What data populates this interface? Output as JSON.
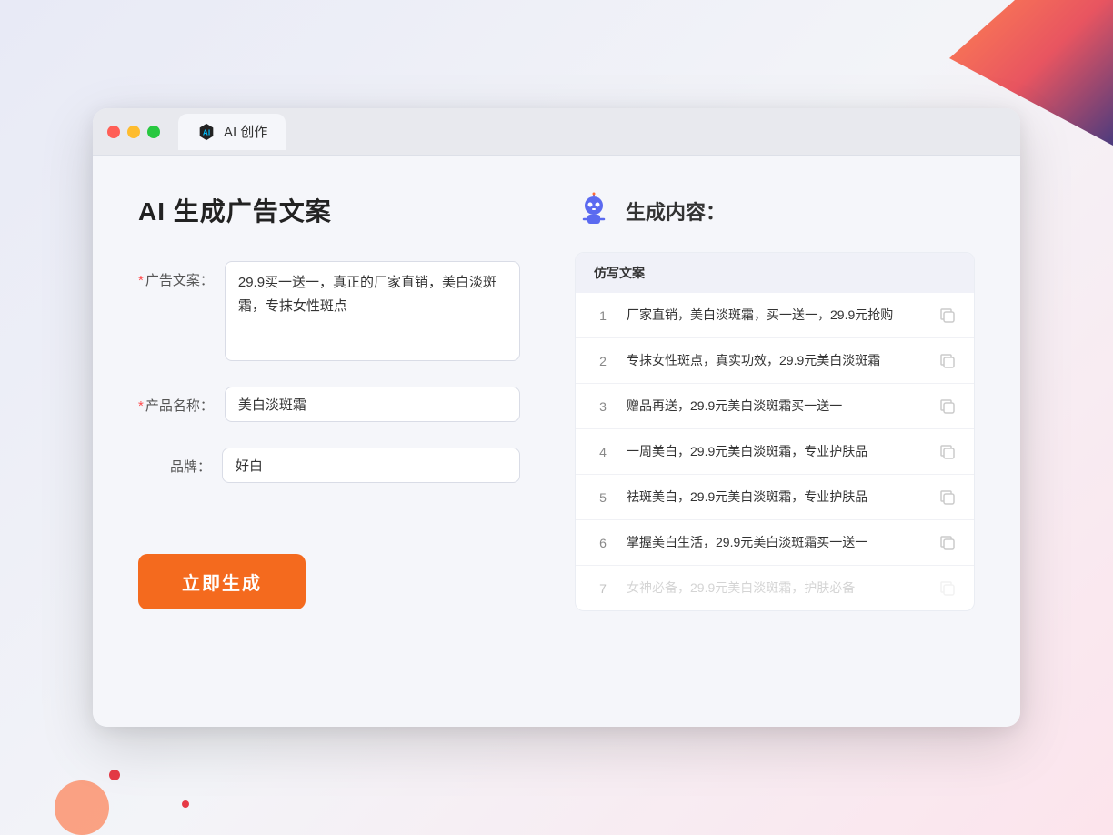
{
  "browser": {
    "tab_title": "AI 创作"
  },
  "page": {
    "title": "AI 生成广告文案",
    "form": {
      "ad_copy_label": "广告文案：",
      "ad_copy_required": "＊",
      "ad_copy_value": "29.9买一送一，真正的厂家直销，美白淡斑霜，专抹女性斑点",
      "product_name_label": "产品名称：",
      "product_name_required": "＊",
      "product_name_value": "美白淡斑霜",
      "brand_label": "品牌：",
      "brand_value": "好白",
      "generate_button": "立即生成"
    },
    "results": {
      "header_title": "生成内容：",
      "column_label": "仿写文案",
      "items": [
        {
          "num": "1",
          "text": "厂家直销，美白淡斑霜，买一送一，29.9元抢购"
        },
        {
          "num": "2",
          "text": "专抹女性斑点，真实功效，29.9元美白淡斑霜"
        },
        {
          "num": "3",
          "text": "赠品再送，29.9元美白淡斑霜买一送一"
        },
        {
          "num": "4",
          "text": "一周美白，29.9元美白淡斑霜，专业护肤品"
        },
        {
          "num": "5",
          "text": "祛斑美白，29.9元美白淡斑霜，专业护肤品"
        },
        {
          "num": "6",
          "text": "掌握美白生活，29.9元美白淡斑霜买一送一"
        },
        {
          "num": "7",
          "text": "女神必备，29.9元美白淡斑霜，护肤必备",
          "dimmed": true
        }
      ]
    }
  }
}
